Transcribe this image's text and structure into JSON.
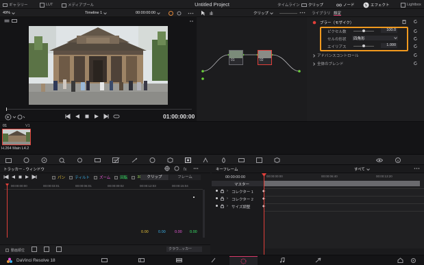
{
  "topbar": {
    "gallery": "ギャラリー",
    "lut": "LUT",
    "media_pool": "メディアプール",
    "project_title": "Untitled Project",
    "timeline": "タイムライン",
    "clips": "クリップ",
    "nodes": "ノード",
    "effects": "エフェクト",
    "lightbox": "Lightbox"
  },
  "viewer": {
    "zoom": "49%",
    "timeline_name": "Timeline 1",
    "timecode_top": "00:00:00:00",
    "timecode_main": "01:00:00:00"
  },
  "node_editor": {
    "mode": "クリップ",
    "node1_label": "01",
    "node2_label": "02"
  },
  "inspector": {
    "tab_library": "ライブラリ",
    "tab_settings": "設定",
    "effect_name": "ブラー（モザイク）",
    "params": [
      {
        "label": "ピクセル数",
        "value": "100.0",
        "fill": 0.35
      },
      {
        "label": "セルの形状",
        "value": "四角形"
      },
      {
        "label": "エイリアス",
        "value": "1.000",
        "fill": 0.35
      }
    ],
    "advanced": "アドバンスコントロール",
    "global_blend": "全体のブレンド"
  },
  "clip_strip": {
    "clip_num": "01",
    "track": "V1",
    "codec": "H.264 Main L4.2"
  },
  "tracker": {
    "title": "トラッカー - ウィンドウ",
    "pan": "パン",
    "tilt": "ティルト",
    "zoom": "ズーム",
    "rotate": "回転",
    "three_d": "3D",
    "tab_clip": "クリップ",
    "tab_frame": "フレーム",
    "ruler": [
      "00:00:00:00",
      "00:00:03:01",
      "00:00:06:01",
      "00:00:09:02",
      "00:00:12:03",
      "00:00:15:04"
    ],
    "values": [
      "0.00",
      "0.00",
      "0.00",
      "0.00"
    ],
    "interactive": "動画順位",
    "cloud_tracker": "クラウ...ッカー"
  },
  "keyframes": {
    "title": "キーフレーム",
    "all": "すべて",
    "timecode": "00:00:00:00",
    "ruler": [
      "00:00:00:00",
      "00:00:06:40",
      "00:00:13:20"
    ],
    "master": "マスター",
    "rows": [
      "コレクター 1",
      "コレクター 2",
      "サイズ調整"
    ]
  },
  "bottombar": {
    "app_name": "DaVinci Resolve 18"
  },
  "colors": {
    "accent_orange": "#f29a1e",
    "playhead_red": "#e2403a",
    "active_pink": "#d8386a",
    "pan_color": "#e8c23a",
    "tilt_color": "#3ab0e8",
    "zoom_color": "#e85ad8",
    "rotate_color": "#3ae86a",
    "three_d_color": "#9ad85a"
  }
}
